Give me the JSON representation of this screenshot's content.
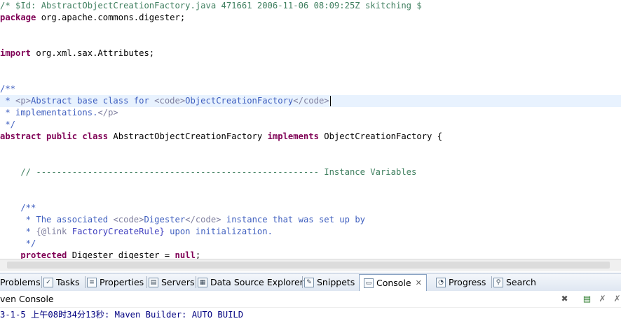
{
  "editor": {
    "lines": [
      [
        {
          "t": "/* $Id: AbstractObjectCreationFactory.java 471661 2006-11-06 08:09:25Z skitching $",
          "c": "c-comment"
        }
      ],
      [
        {
          "t": "package",
          "c": "c-kw"
        },
        {
          "t": " org.apache.commons.digester;",
          "c": "c-plain"
        }
      ],
      [],
      [],
      [
        {
          "t": "import",
          "c": "c-kw"
        },
        {
          "t": " org.xml.sax.Attributes;",
          "c": "c-plain"
        }
      ],
      [],
      [],
      [
        {
          "t": "/**",
          "c": "c-doc"
        }
      ],
      [
        {
          "t": " * ",
          "c": "c-doc"
        },
        {
          "t": "<p>",
          "c": "c-tag"
        },
        {
          "t": "Abstract base class for ",
          "c": "c-doc"
        },
        {
          "t": "<code>",
          "c": "c-tag"
        },
        {
          "t": "ObjectCreationFactory",
          "c": "c-doc"
        },
        {
          "t": "</code>",
          "c": "c-tag"
        }
      ],
      [
        {
          "t": " * implementations.",
          "c": "c-doc"
        },
        {
          "t": "</p>",
          "c": "c-tag"
        }
      ],
      [
        {
          "t": " */",
          "c": "c-doc"
        }
      ],
      [
        {
          "t": "abstract public class",
          "c": "c-kw"
        },
        {
          "t": " AbstractObjectCreationFactory ",
          "c": "c-plain"
        },
        {
          "t": "implements",
          "c": "c-kw"
        },
        {
          "t": " ObjectCreationFactory {",
          "c": "c-plain"
        }
      ],
      [],
      [],
      [
        {
          "t": "    // ------------------------------------------------------- Instance Variables",
          "c": "c-comment"
        }
      ],
      [],
      [],
      [
        {
          "t": "    /**",
          "c": "c-doc"
        }
      ],
      [
        {
          "t": "     * The associated ",
          "c": "c-doc"
        },
        {
          "t": "<code>",
          "c": "c-tag"
        },
        {
          "t": "Digester",
          "c": "c-doc"
        },
        {
          "t": "</code>",
          "c": "c-tag"
        },
        {
          "t": " instance that was set up by",
          "c": "c-doc"
        }
      ],
      [
        {
          "t": "     * ",
          "c": "c-doc"
        },
        {
          "t": "{@link",
          "c": "c-tag"
        },
        {
          "t": " FactoryCreateRule}",
          "c": "c-link"
        },
        {
          "t": " upon initialization.",
          "c": "c-doc"
        }
      ],
      [
        {
          "t": "     */",
          "c": "c-doc"
        }
      ],
      [
        {
          "t": "    protected",
          "c": "c-kw"
        },
        {
          "t": " Digester digester = ",
          "c": "c-plain"
        },
        {
          "t": "null",
          "c": "c-kw"
        },
        {
          "t": ";",
          "c": "c-plain"
        }
      ]
    ],
    "current_line": 8
  },
  "tabs": [
    {
      "label": "Problems",
      "icon": "problems-icon",
      "glyph": "!"
    },
    {
      "label": "Tasks",
      "icon": "tasks-icon",
      "glyph": "✓"
    },
    {
      "label": "Properties",
      "icon": "properties-icon",
      "glyph": "≡"
    },
    {
      "label": "Servers",
      "icon": "servers-icon",
      "glyph": "▤"
    },
    {
      "label": "Data Source Explorer",
      "icon": "data-source-icon",
      "glyph": "▦"
    },
    {
      "label": "Snippets",
      "icon": "snippets-icon",
      "glyph": "✎"
    },
    {
      "label": "Console",
      "icon": "console-icon",
      "glyph": "▭",
      "active": true,
      "close": "✕"
    },
    {
      "label": "Progress",
      "icon": "progress-icon",
      "glyph": "◔"
    },
    {
      "label": "Search",
      "icon": "search-icon",
      "glyph": "⚲"
    }
  ],
  "console": {
    "title": "ven Console",
    "output": "3-1-5 上午08时34分13秒: Maven Builder: AUTO BUILD",
    "toolbar": [
      {
        "name": "terminate-icon",
        "glyph": "✖"
      },
      {
        "name": "clear-console-icon",
        "glyph": "▤"
      },
      {
        "name": "remove-launch-icon",
        "glyph": "✗"
      },
      {
        "name": "remove-all-icon",
        "glyph": "✗"
      }
    ]
  },
  "colors": {
    "comment": "#3f7f5f",
    "javadoc": "#3f5fbf",
    "keyword": "#7f0055",
    "current_line": "#e8f2fe",
    "console_text": "#000080"
  }
}
